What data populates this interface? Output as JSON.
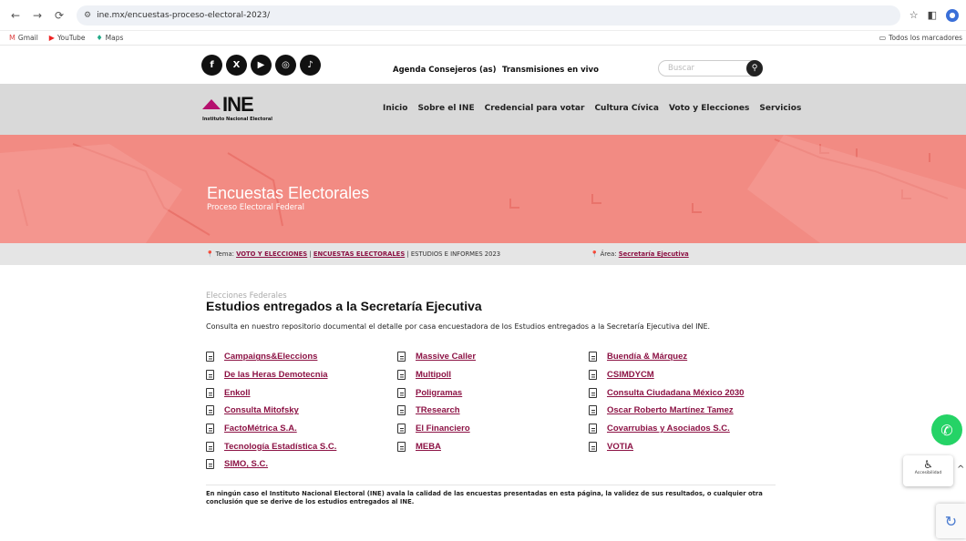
{
  "browser": {
    "url": "ine.mx/encuestas-proceso-electoral-2023/",
    "bookmarks": [
      {
        "label": "Gmail",
        "icon": "gmail-icon"
      },
      {
        "label": "YouTube",
        "icon": "youtube-icon"
      },
      {
        "label": "Maps",
        "icon": "maps-icon"
      }
    ],
    "all_bookmarks": "Todos los marcadores"
  },
  "topbar": {
    "social": [
      "facebook-icon",
      "x-icon",
      "youtube-icon",
      "instagram-icon",
      "tiktok-icon"
    ],
    "links": [
      "Agenda Consejeros (as)",
      "Transmisiones en vivo"
    ],
    "search_placeholder": "Buscar"
  },
  "logo": {
    "text": "INE",
    "subtitle": "Instituto Nacional Electoral"
  },
  "menu": [
    "Inicio",
    "Sobre el INE",
    "Credencial para votar",
    "Cultura Cívica",
    "Voto y Elecciones",
    "Servicios"
  ],
  "hero": {
    "title": "Encuestas Electorales",
    "subtitle": "Proceso Electoral Federal",
    "color": "#f28b83"
  },
  "breadcrumb": {
    "tema_label": "Tema:",
    "tema_links": [
      "VOTO Y ELECCIONES",
      "ENCUESTAS ELECTORALES"
    ],
    "tema_current": "ESTUDIOS E INFORMES 2023",
    "area_label": "Área:",
    "area_link": "Secretaría Ejecutiva"
  },
  "content": {
    "faint": "Elecciones Federales",
    "heading": "Estudios entregados a la Secretaría Ejecutiva",
    "intro": "Consulta en nuestro repositorio documental el detalle por casa encuestadora de los Estudios entregados a la Secretaría Ejecutiva del INE.",
    "columns": [
      [
        "Campaigns&Eleccions",
        "De las Heras Demotecnia",
        "Enkoll",
        "Consulta Mitofsky",
        "FactoMétrica S.A.",
        "Tecnología Estadística S.C.",
        "SIMO, S.C."
      ],
      [
        "Massive Caller",
        "Multipoll",
        "Poligramas",
        "TResearch",
        "El Financiero",
        "MEBA"
      ],
      [
        "Buendía & Márquez",
        "CSIMDYCM",
        "Consulta Ciudadana México 2030",
        "Oscar Roberto Martínez Tamez",
        "Covarrubias y Asociados S.C.",
        "VOTIA"
      ]
    ],
    "disclaimer": "En ningún caso el Instituto Nacional Electoral (INE) avala la calidad de las encuestas presentadas en esta página, la validez de sus resultados, o cualquier otra conclusión que se derive de los estudios entregados al INE."
  },
  "widgets": {
    "accessibility_label": "Accesibilidad"
  },
  "colors": {
    "link": "#8c1244",
    "brand_magenta": "#b5106e",
    "nav_gray": "#d9d9d9",
    "whatsapp": "#25d366"
  }
}
